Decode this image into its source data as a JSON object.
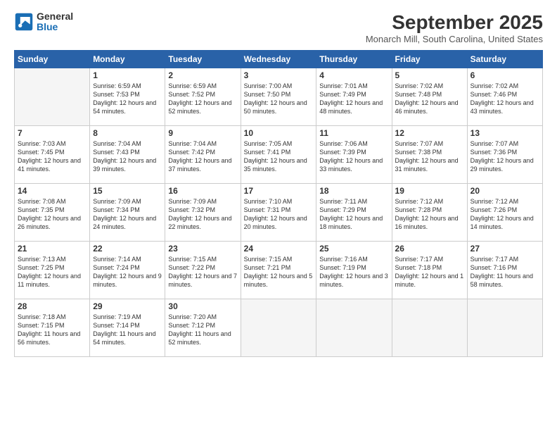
{
  "header": {
    "logo_line1": "General",
    "logo_line2": "Blue",
    "month_title": "September 2025",
    "location": "Monarch Mill, South Carolina, United States"
  },
  "weekdays": [
    "Sunday",
    "Monday",
    "Tuesday",
    "Wednesday",
    "Thursday",
    "Friday",
    "Saturday"
  ],
  "weeks": [
    [
      {
        "day": "",
        "sunrise": "",
        "sunset": "",
        "daylight": "",
        "empty": true
      },
      {
        "day": "1",
        "sunrise": "Sunrise: 6:59 AM",
        "sunset": "Sunset: 7:53 PM",
        "daylight": "Daylight: 12 hours and 54 minutes."
      },
      {
        "day": "2",
        "sunrise": "Sunrise: 6:59 AM",
        "sunset": "Sunset: 7:52 PM",
        "daylight": "Daylight: 12 hours and 52 minutes."
      },
      {
        "day": "3",
        "sunrise": "Sunrise: 7:00 AM",
        "sunset": "Sunset: 7:50 PM",
        "daylight": "Daylight: 12 hours and 50 minutes."
      },
      {
        "day": "4",
        "sunrise": "Sunrise: 7:01 AM",
        "sunset": "Sunset: 7:49 PM",
        "daylight": "Daylight: 12 hours and 48 minutes."
      },
      {
        "day": "5",
        "sunrise": "Sunrise: 7:02 AM",
        "sunset": "Sunset: 7:48 PM",
        "daylight": "Daylight: 12 hours and 46 minutes."
      },
      {
        "day": "6",
        "sunrise": "Sunrise: 7:02 AM",
        "sunset": "Sunset: 7:46 PM",
        "daylight": "Daylight: 12 hours and 43 minutes."
      }
    ],
    [
      {
        "day": "7",
        "sunrise": "Sunrise: 7:03 AM",
        "sunset": "Sunset: 7:45 PM",
        "daylight": "Daylight: 12 hours and 41 minutes."
      },
      {
        "day": "8",
        "sunrise": "Sunrise: 7:04 AM",
        "sunset": "Sunset: 7:43 PM",
        "daylight": "Daylight: 12 hours and 39 minutes."
      },
      {
        "day": "9",
        "sunrise": "Sunrise: 7:04 AM",
        "sunset": "Sunset: 7:42 PM",
        "daylight": "Daylight: 12 hours and 37 minutes."
      },
      {
        "day": "10",
        "sunrise": "Sunrise: 7:05 AM",
        "sunset": "Sunset: 7:41 PM",
        "daylight": "Daylight: 12 hours and 35 minutes."
      },
      {
        "day": "11",
        "sunrise": "Sunrise: 7:06 AM",
        "sunset": "Sunset: 7:39 PM",
        "daylight": "Daylight: 12 hours and 33 minutes."
      },
      {
        "day": "12",
        "sunrise": "Sunrise: 7:07 AM",
        "sunset": "Sunset: 7:38 PM",
        "daylight": "Daylight: 12 hours and 31 minutes."
      },
      {
        "day": "13",
        "sunrise": "Sunrise: 7:07 AM",
        "sunset": "Sunset: 7:36 PM",
        "daylight": "Daylight: 12 hours and 29 minutes."
      }
    ],
    [
      {
        "day": "14",
        "sunrise": "Sunrise: 7:08 AM",
        "sunset": "Sunset: 7:35 PM",
        "daylight": "Daylight: 12 hours and 26 minutes."
      },
      {
        "day": "15",
        "sunrise": "Sunrise: 7:09 AM",
        "sunset": "Sunset: 7:34 PM",
        "daylight": "Daylight: 12 hours and 24 minutes."
      },
      {
        "day": "16",
        "sunrise": "Sunrise: 7:09 AM",
        "sunset": "Sunset: 7:32 PM",
        "daylight": "Daylight: 12 hours and 22 minutes."
      },
      {
        "day": "17",
        "sunrise": "Sunrise: 7:10 AM",
        "sunset": "Sunset: 7:31 PM",
        "daylight": "Daylight: 12 hours and 20 minutes."
      },
      {
        "day": "18",
        "sunrise": "Sunrise: 7:11 AM",
        "sunset": "Sunset: 7:29 PM",
        "daylight": "Daylight: 12 hours and 18 minutes."
      },
      {
        "day": "19",
        "sunrise": "Sunrise: 7:12 AM",
        "sunset": "Sunset: 7:28 PM",
        "daylight": "Daylight: 12 hours and 16 minutes."
      },
      {
        "day": "20",
        "sunrise": "Sunrise: 7:12 AM",
        "sunset": "Sunset: 7:26 PM",
        "daylight": "Daylight: 12 hours and 14 minutes."
      }
    ],
    [
      {
        "day": "21",
        "sunrise": "Sunrise: 7:13 AM",
        "sunset": "Sunset: 7:25 PM",
        "daylight": "Daylight: 12 hours and 11 minutes."
      },
      {
        "day": "22",
        "sunrise": "Sunrise: 7:14 AM",
        "sunset": "Sunset: 7:24 PM",
        "daylight": "Daylight: 12 hours and 9 minutes."
      },
      {
        "day": "23",
        "sunrise": "Sunrise: 7:15 AM",
        "sunset": "Sunset: 7:22 PM",
        "daylight": "Daylight: 12 hours and 7 minutes."
      },
      {
        "day": "24",
        "sunrise": "Sunrise: 7:15 AM",
        "sunset": "Sunset: 7:21 PM",
        "daylight": "Daylight: 12 hours and 5 minutes."
      },
      {
        "day": "25",
        "sunrise": "Sunrise: 7:16 AM",
        "sunset": "Sunset: 7:19 PM",
        "daylight": "Daylight: 12 hours and 3 minutes."
      },
      {
        "day": "26",
        "sunrise": "Sunrise: 7:17 AM",
        "sunset": "Sunset: 7:18 PM",
        "daylight": "Daylight: 12 hours and 1 minute."
      },
      {
        "day": "27",
        "sunrise": "Sunrise: 7:17 AM",
        "sunset": "Sunset: 7:16 PM",
        "daylight": "Daylight: 11 hours and 58 minutes."
      }
    ],
    [
      {
        "day": "28",
        "sunrise": "Sunrise: 7:18 AM",
        "sunset": "Sunset: 7:15 PM",
        "daylight": "Daylight: 11 hours and 56 minutes."
      },
      {
        "day": "29",
        "sunrise": "Sunrise: 7:19 AM",
        "sunset": "Sunset: 7:14 PM",
        "daylight": "Daylight: 11 hours and 54 minutes."
      },
      {
        "day": "30",
        "sunrise": "Sunrise: 7:20 AM",
        "sunset": "Sunset: 7:12 PM",
        "daylight": "Daylight: 11 hours and 52 minutes."
      },
      {
        "day": "",
        "sunrise": "",
        "sunset": "",
        "daylight": "",
        "empty": true
      },
      {
        "day": "",
        "sunrise": "",
        "sunset": "",
        "daylight": "",
        "empty": true
      },
      {
        "day": "",
        "sunrise": "",
        "sunset": "",
        "daylight": "",
        "empty": true
      },
      {
        "day": "",
        "sunrise": "",
        "sunset": "",
        "daylight": "",
        "empty": true
      }
    ]
  ]
}
